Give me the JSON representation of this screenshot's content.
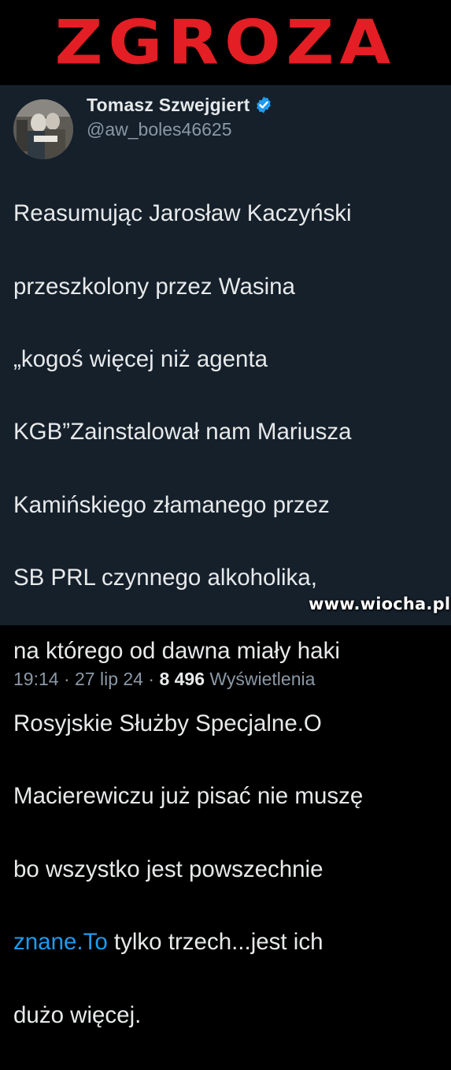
{
  "banner": {
    "title": "ZGROZA"
  },
  "tweet": {
    "author_name": "Tomasz Szwejgiert",
    "author_handle": "@aw_boles46625",
    "text_lines": [
      "Reasumując Jarosław Kaczyński",
      "przeszkolony przez Wasina",
      "„kogoś więcej niż agenta",
      "KGB”Zainstalował nam Mariusza",
      "Kamińskiego złamanego przez",
      "SB PRL czynnego alkoholika,",
      "na którego od dawna miały haki",
      "Rosyjskie Służby Specjalne.O",
      "Macierewiczu już pisać nie muszę",
      "bo wszystko jest powszechnie"
    ],
    "link_text": "znane.To",
    "text_after_link": " tylko trzech...jest ich",
    "last_line": "dużo więcej.",
    "time": "19:14",
    "date": "27 lip 24",
    "views_count": "8 496",
    "views_label": "Wyświetlenia"
  },
  "watermark": "www.wiocha.pl",
  "colors": {
    "banner_red": "#e31e24",
    "background": "#15202b",
    "link": "#1d9bf0",
    "verified": "#1d9bf0"
  },
  "icons": {
    "verified": "verified-badge-icon"
  }
}
